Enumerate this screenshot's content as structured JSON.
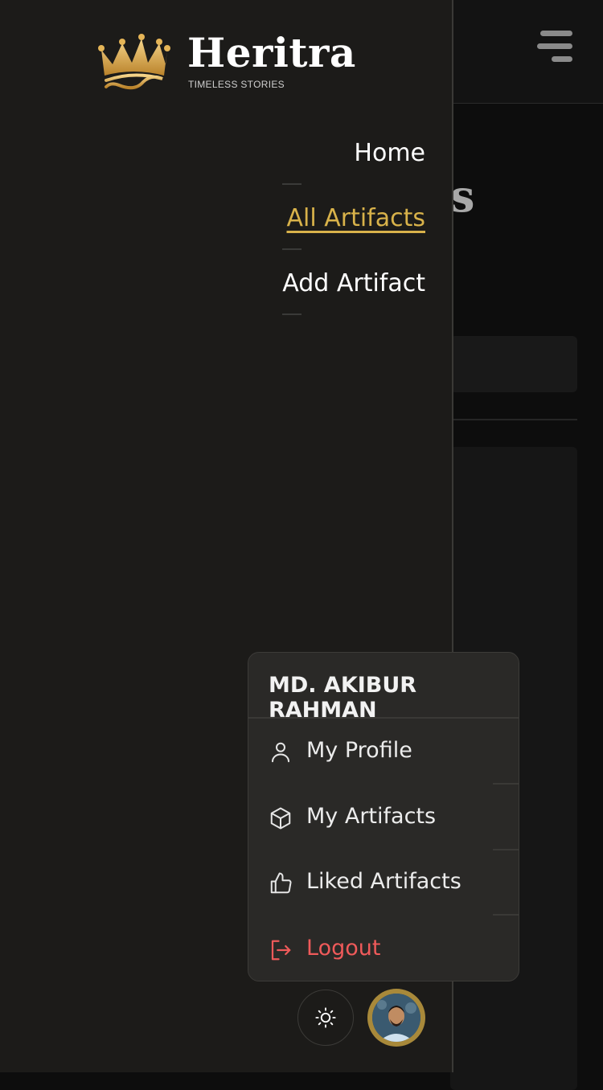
{
  "brand": {
    "name": "Heritra",
    "tagline": "TIMELESS STORIES"
  },
  "nav": {
    "items": [
      {
        "label": "Home",
        "active": false
      },
      {
        "label": "All Artifacts",
        "active": true
      },
      {
        "label": "Add Artifact",
        "active": false
      }
    ]
  },
  "background_page": {
    "heading_fragment": "s"
  },
  "user_menu": {
    "name": "MD. AKIBUR RAHMAN",
    "items": [
      {
        "label": "My Profile",
        "icon": "user-icon"
      },
      {
        "label": "My Artifacts",
        "icon": "box-icon"
      },
      {
        "label": "Liked Artifacts",
        "icon": "thumbs-up-icon"
      },
      {
        "label": "Logout",
        "icon": "logout-icon"
      }
    ]
  },
  "colors": {
    "accent": "#d8b24a",
    "logout": "#ef5a5a",
    "drawer_bg": "#1c1b19"
  }
}
